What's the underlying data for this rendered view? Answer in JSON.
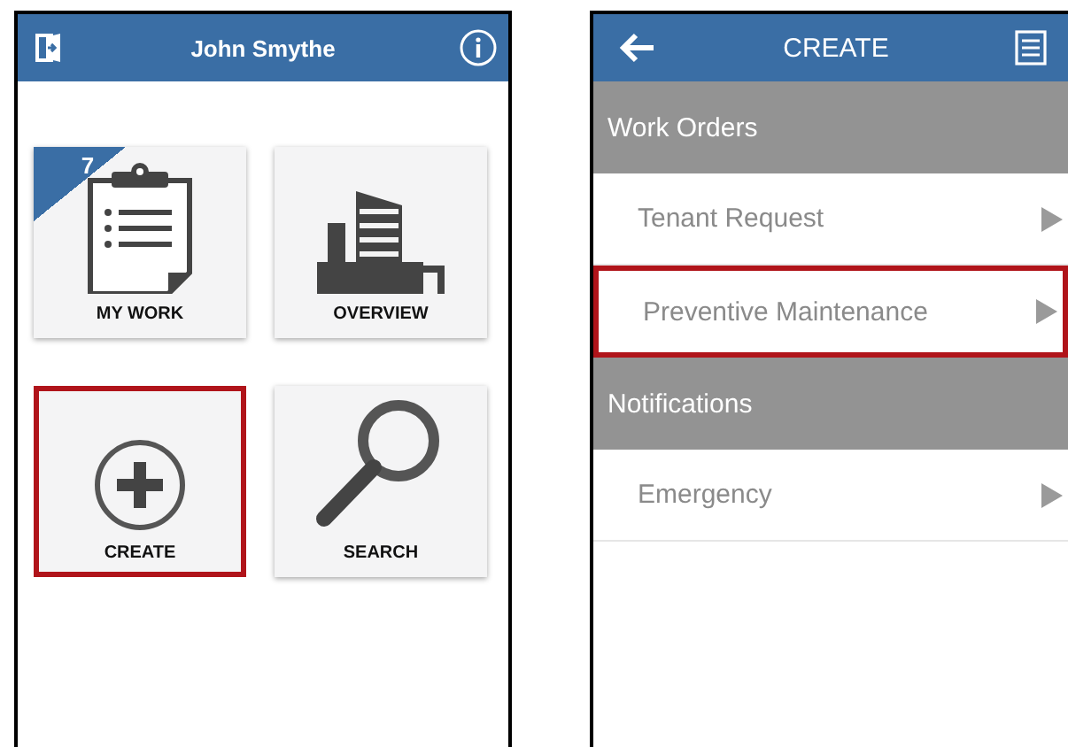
{
  "home_screen": {
    "header": {
      "title": "John Smythe"
    },
    "tiles": [
      {
        "kind": "clipboard",
        "label": "MY WORK",
        "badge": "7",
        "selected": false
      },
      {
        "kind": "building",
        "label": "OVERVIEW",
        "selected": false
      },
      {
        "kind": "plus",
        "label": "CREATE",
        "selected": true
      },
      {
        "kind": "search",
        "label": "SEARCH",
        "selected": false
      }
    ]
  },
  "create_screen": {
    "header": {
      "title": "CREATE"
    },
    "sections": [
      {
        "title": "Work Orders",
        "items": [
          {
            "label": "Tenant Request",
            "selected": false
          },
          {
            "label": "Preventive Maintenance",
            "selected": true
          }
        ]
      },
      {
        "title": "Notifications",
        "items": [
          {
            "label": "Emergency",
            "selected": false
          }
        ]
      }
    ]
  }
}
